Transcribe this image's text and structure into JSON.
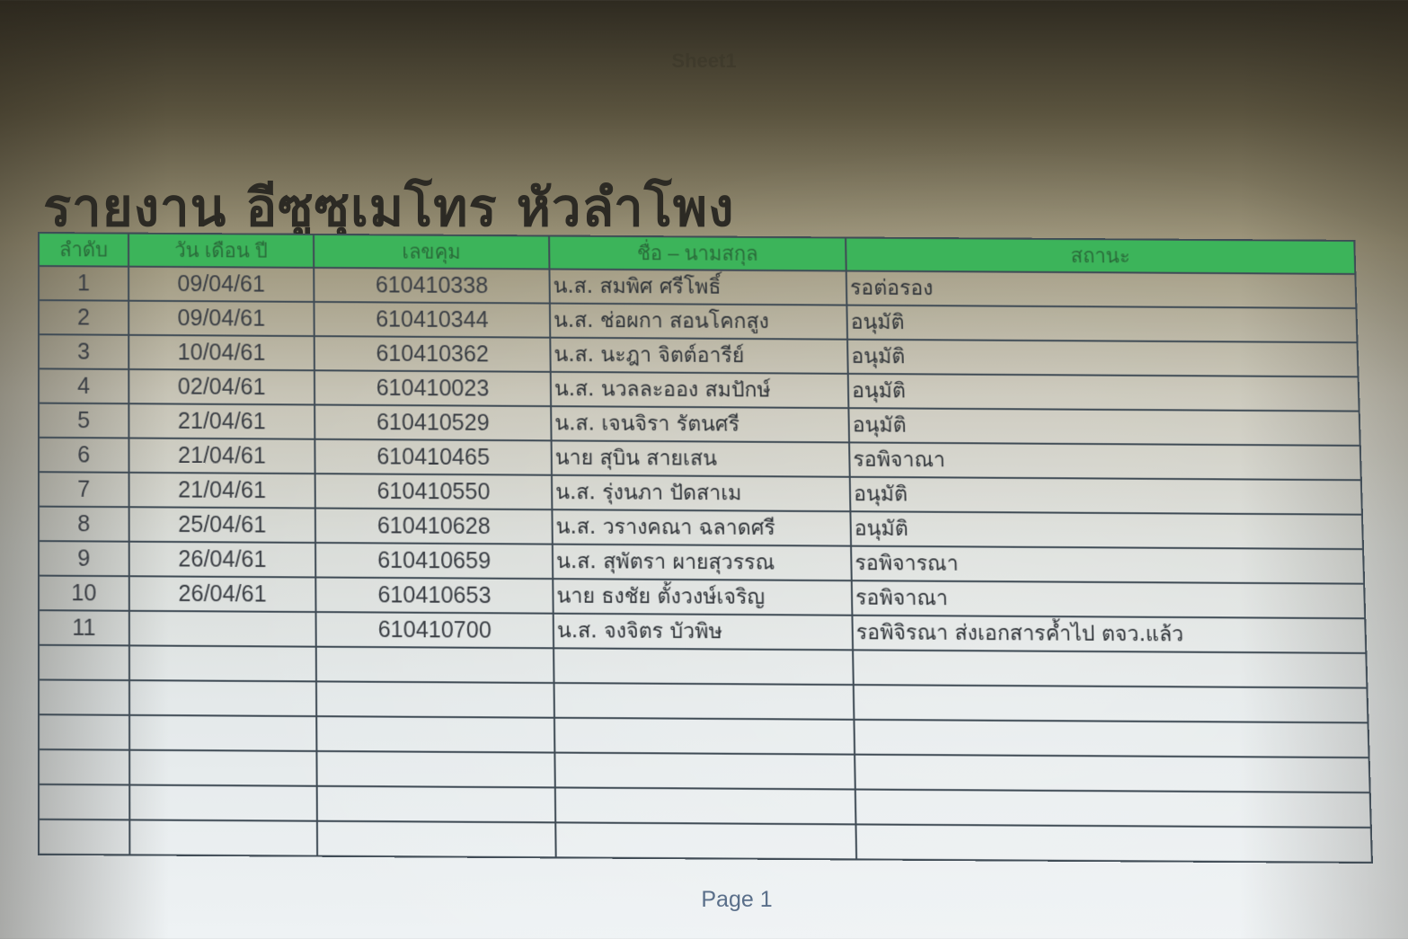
{
  "sheet_name": "Sheet1",
  "title": "รายงาน อีซูซุเมโทร หัวลำโพง",
  "table": {
    "headers": [
      "ลำดับ",
      "วัน เดือน ปี",
      "เลขคุม",
      "ชื่อ – นามสกุล",
      "สถานะ"
    ],
    "rows": [
      [
        "1",
        "09/04/61",
        "610410338",
        "น.ส. สมพิศ ศรีโพธิ์",
        "รอต่อรอง"
      ],
      [
        "2",
        "09/04/61",
        "610410344",
        "น.ส. ช่อผกา สอนโคกสูง",
        "อนุมัติ"
      ],
      [
        "3",
        "10/04/61",
        "610410362",
        "น.ส. นะฎา จิตต์อารีย์",
        "อนุมัติ"
      ],
      [
        "4",
        "02/04/61",
        "610410023",
        "น.ส. นวลละออง สมปักษ์",
        "อนุมัติ"
      ],
      [
        "5",
        "21/04/61",
        "610410529",
        "น.ส. เจนจิรา รัตนศรี",
        "อนุมัติ"
      ],
      [
        "6",
        "21/04/61",
        "610410465",
        "นาย สุบิน สายเสน",
        "รอพิจาณา"
      ],
      [
        "7",
        "21/04/61",
        "610410550",
        "น.ส. รุ่งนภา ปัดสาเม",
        "อนุมัติ"
      ],
      [
        "8",
        "25/04/61",
        "610410628",
        "น.ส. วรางคณา ฉลาดศรี",
        "อนุมัติ"
      ],
      [
        "9",
        "26/04/61",
        "610410659",
        "น.ส. สุพัตรา ผายสุวรรณ",
        "รอพิจารณา"
      ],
      [
        "10",
        "26/04/61",
        "610410653",
        "นาย ธงชัย ตั้งวงษ์เจริญ",
        "รอพิจาณา"
      ],
      [
        "11",
        "",
        "610410700",
        "น.ส. จงจิตร บัวพิษ",
        "รอพิจิรณา ส่งเอกสารค้ำไป ตจว.แล้ว"
      ],
      [
        "",
        "",
        "",
        "",
        ""
      ],
      [
        "",
        "",
        "",
        "",
        ""
      ],
      [
        "",
        "",
        "",
        "",
        ""
      ],
      [
        "",
        "",
        "",
        "",
        ""
      ],
      [
        "",
        "",
        "",
        "",
        ""
      ],
      [
        "",
        "",
        "",
        "",
        ""
      ]
    ]
  },
  "page_label": "Page 1"
}
